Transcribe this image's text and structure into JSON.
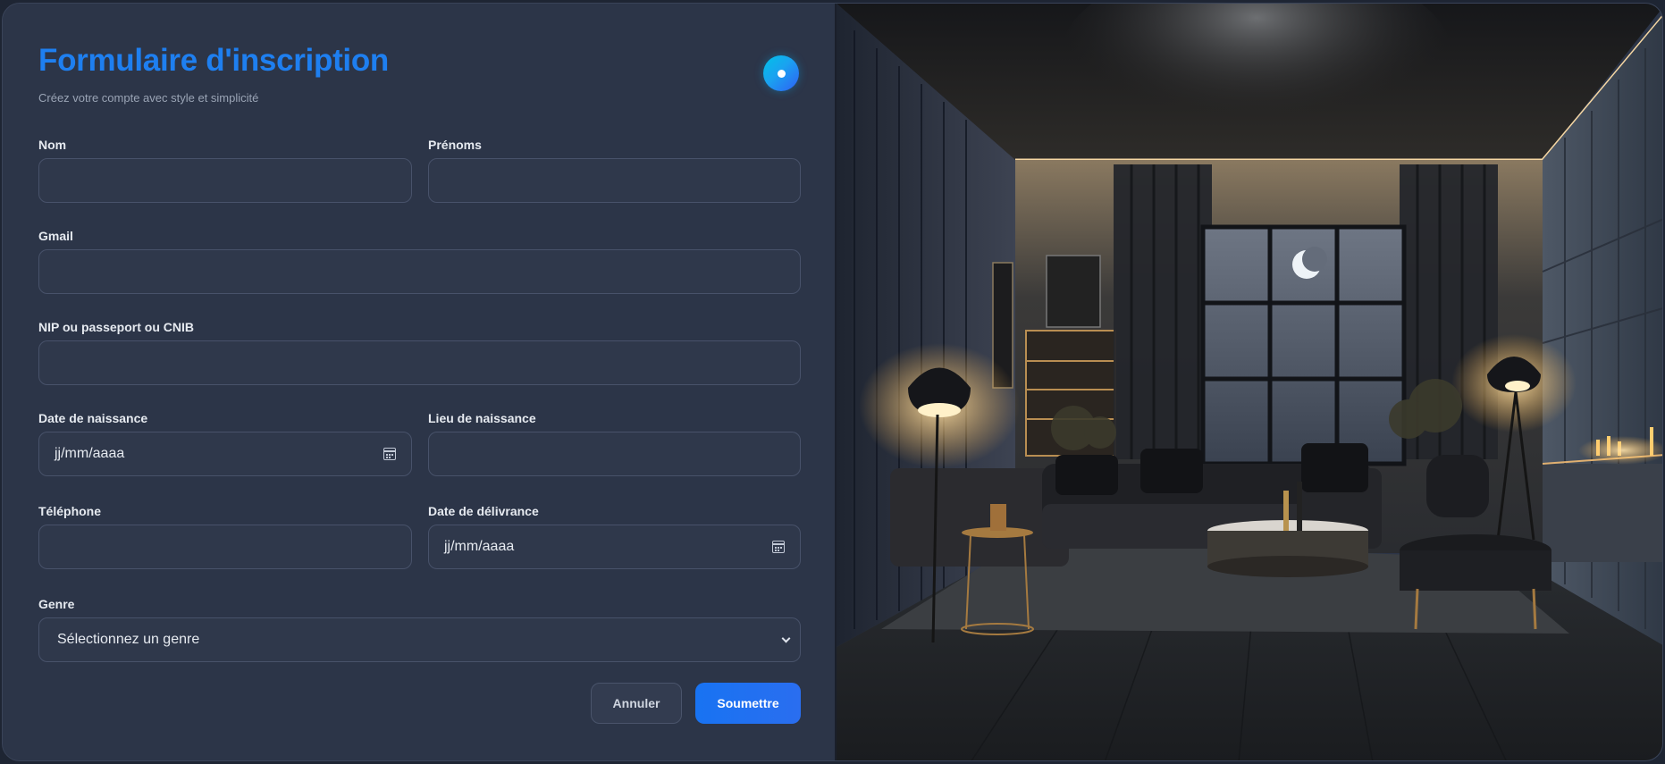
{
  "form": {
    "title": "Formulaire d'inscription",
    "subtitle": "Créez votre compte avec style et simplicité",
    "fields": {
      "nom": {
        "label": "Nom",
        "value": ""
      },
      "prenoms": {
        "label": "Prénoms",
        "value": ""
      },
      "gmail": {
        "label": "Gmail",
        "value": ""
      },
      "nip": {
        "label": "NIP ou passeport ou CNIB",
        "value": ""
      },
      "date_naissance": {
        "label": "Date de naissance",
        "placeholder": "jj/mm/aaaa"
      },
      "lieu_naissance": {
        "label": "Lieu de naissance",
        "value": ""
      },
      "telephone": {
        "label": "Téléphone",
        "value": ""
      },
      "date_delivrance": {
        "label": "Date de délivrance",
        "placeholder": "jj/mm/aaaa"
      },
      "genre": {
        "label": "Genre",
        "selected": "Sélectionnez un genre"
      }
    },
    "buttons": {
      "cancel": "Annuler",
      "submit": "Soumettre"
    }
  },
  "colors": {
    "accent": "#1e7ff0",
    "panel_bg": "#2c3548",
    "submit_bg": "#1873f2"
  },
  "icons": {
    "theme_toggle": "toggle-icon",
    "date": "calendar-icon",
    "select": "chevron-down-icon"
  }
}
